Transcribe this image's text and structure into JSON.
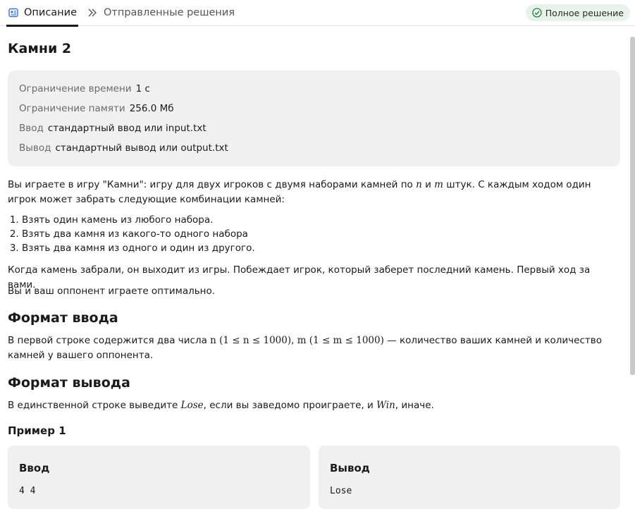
{
  "tabs": {
    "description": "Описание",
    "submissions": "Отправленные решения"
  },
  "badge": "Полное решение",
  "problem": {
    "title": "Камни 2",
    "limits": [
      {
        "key": "Ограничение времени",
        "value": "1 с"
      },
      {
        "key": "Ограничение памяти",
        "value": "256.0 Мб"
      },
      {
        "key": "Ввод",
        "value": "стандартный ввод или input.txt"
      },
      {
        "key": "Вывод",
        "value": "стандартный вывод или output.txt"
      }
    ],
    "statement": {
      "intro_a": "Вы играете в игру \"Камни\": игру для двух игроков с двумя наборами камней по ",
      "n": "n",
      "and": " и ",
      "m": "m",
      "intro_b": " штук. С каждым ходом один игрок может забрать следующие комбинации камней:",
      "moves": [
        "Взять один камень из любого набора.",
        "Взять два камня из какого-то одного набора",
        "Взять два камня из одного и один из другого."
      ],
      "rule": "Когда камень забрали, он выходит из игры. Побеждает игрок, который заберет последний камень. Первый ход за вами.",
      "optimal": "Вы и ваш оппонент играете оптимально."
    },
    "input_format": {
      "heading": "Формат ввода",
      "text_a": "В первой строке содержится два числа ",
      "n_constraint": "n (1 ≤ n ≤ 1000)",
      "comma": ", ",
      "m_constraint": "m (1 ≤ m ≤ 1000)",
      "text_b": " — количество ваших камней и количество камней у вашего оппонента."
    },
    "output_format": {
      "heading": "Формат вывода",
      "text_a": "В единственной строке выведите ",
      "lose": "Lose",
      "text_b": ", если вы заведомо проиграете, и ",
      "win": "Win",
      "text_c": ", иначе."
    },
    "example": {
      "heading": "Пример 1",
      "input_label": "Ввод",
      "input_value": "4 4",
      "output_label": "Вывод",
      "output_value": "Lose"
    }
  }
}
